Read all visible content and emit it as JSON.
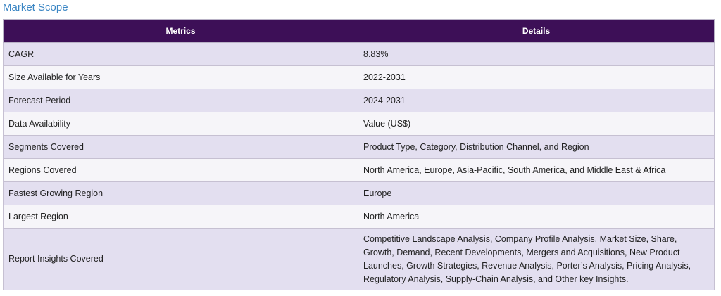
{
  "section_title": "Market Scope",
  "table": {
    "headers": [
      "Metrics",
      "Details"
    ],
    "rows": [
      {
        "metric": "CAGR",
        "detail": "8.83%"
      },
      {
        "metric": "Size Available for Years",
        "detail": "2022-2031"
      },
      {
        "metric": "Forecast Period",
        "detail": "2024-2031"
      },
      {
        "metric": "Data Availability",
        "detail": "Value (US$)"
      },
      {
        "metric": "Segments Covered",
        "detail": "Product Type, Category, Distribution Channel, and Region"
      },
      {
        "metric": "Regions Covered",
        "detail": "North America, Europe, Asia-Pacific, South America, and Middle East & Africa"
      },
      {
        "metric": "Fastest Growing Region",
        "detail": "Europe"
      },
      {
        "metric": "Largest Region",
        "detail": "North America"
      },
      {
        "metric": "Report Insights Covered",
        "detail": "Competitive Landscape Analysis, Company Profile Analysis, Market Size, Share, Growth, Demand, Recent Developments, Mergers and Acquisitions, New Product Launches, Growth Strategies, Revenue Analysis, Porter’s Analysis, Pricing Analysis, Regulatory Analysis, Supply-Chain Analysis, and Other key Insights."
      }
    ]
  },
  "colors": {
    "title": "#3b86c4",
    "header_bg": "#3d0f57",
    "row_odd": "#e3dff0",
    "row_even": "#f6f5f9"
  }
}
